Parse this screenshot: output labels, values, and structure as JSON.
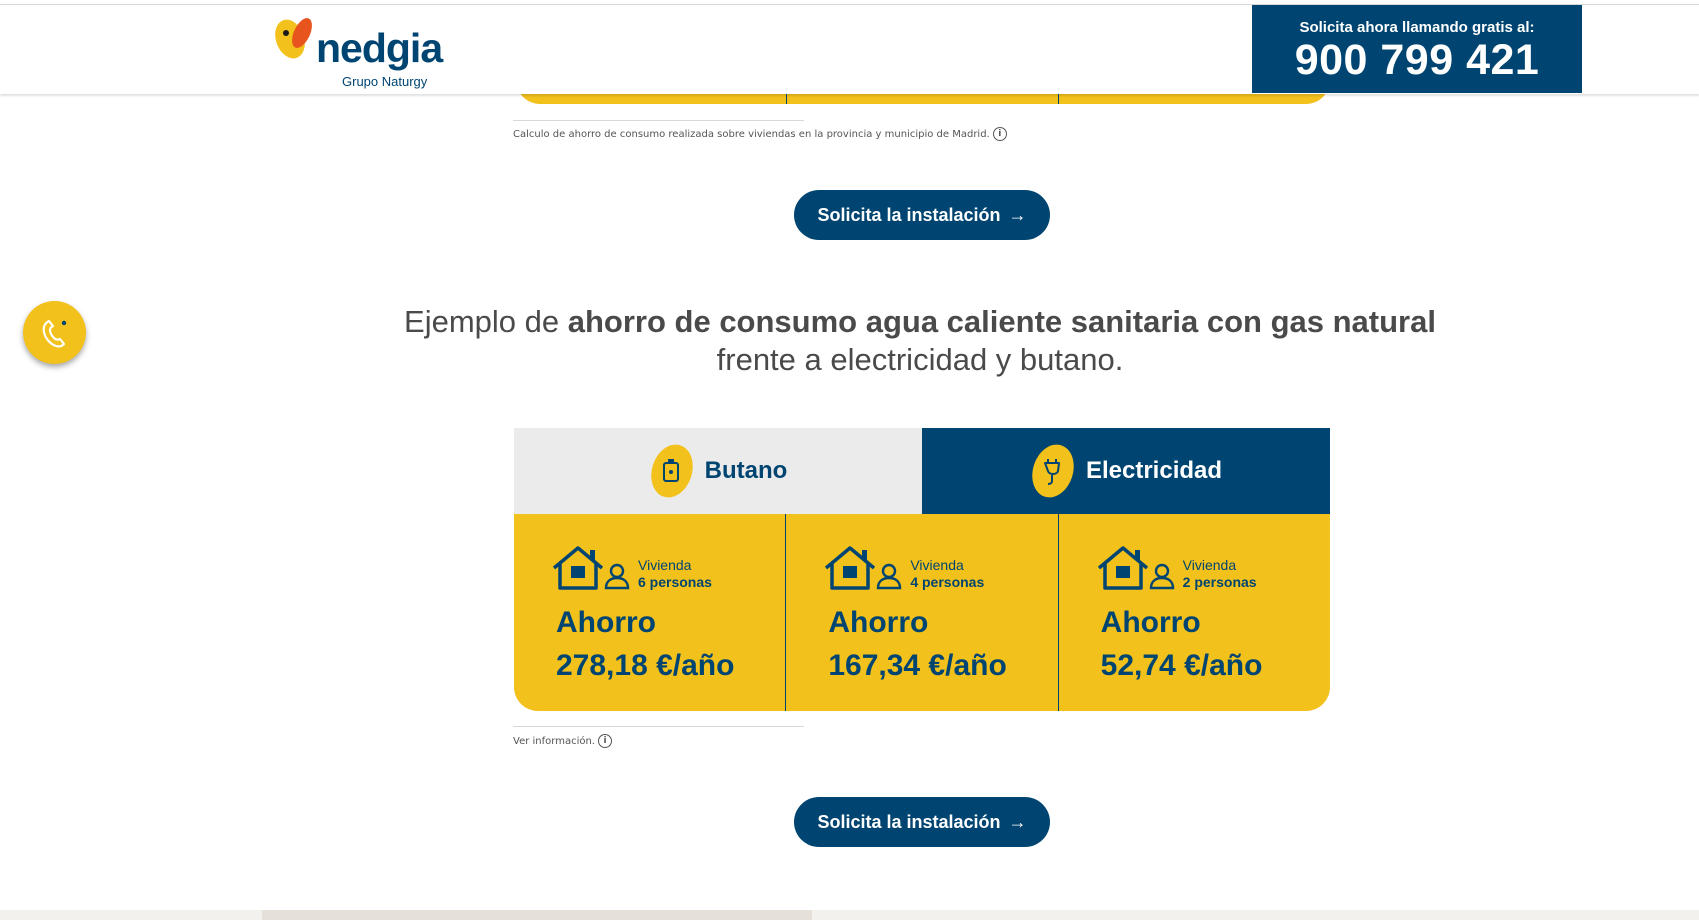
{
  "header": {
    "logo_word": "nedgia",
    "logo_sub": "Grupo Naturgy",
    "phone_label": "Solicita ahora llamando gratis al:",
    "phone_number": "900 799 421"
  },
  "previous_section": {
    "note": "Calculo de ahorro de consumo realizada sobre viviendas en la provincia y municipio de Madrid.",
    "cta": "Solicita la instalación"
  },
  "section": {
    "headline_pre": "Ejemplo de ",
    "headline_bold": "ahorro de consumo agua caliente sanitaria con gas natural",
    "headline_post": "frente a electricidad y butano.",
    "tabs": [
      {
        "label": "Butano",
        "icon": "gas-bottle-icon"
      },
      {
        "label": "Electricidad",
        "icon": "plug-icon"
      }
    ],
    "cards": [
      {
        "vivienda": "Vivienda",
        "personas": "6 personas",
        "ahorro": "Ahorro",
        "amount": "278,18 €/año"
      },
      {
        "vivienda": "Vivienda",
        "personas": "4 personas",
        "ahorro": "Ahorro",
        "amount": "167,34 €/año"
      },
      {
        "vivienda": "Vivienda",
        "personas": "2 personas",
        "ahorro": "Ahorro",
        "amount": "52,74 €/año"
      }
    ],
    "note": "Ver información.",
    "cta": "Solicita la instalación"
  },
  "colors": {
    "brand_blue": "#004571",
    "brand_yellow": "#f2c11c"
  }
}
